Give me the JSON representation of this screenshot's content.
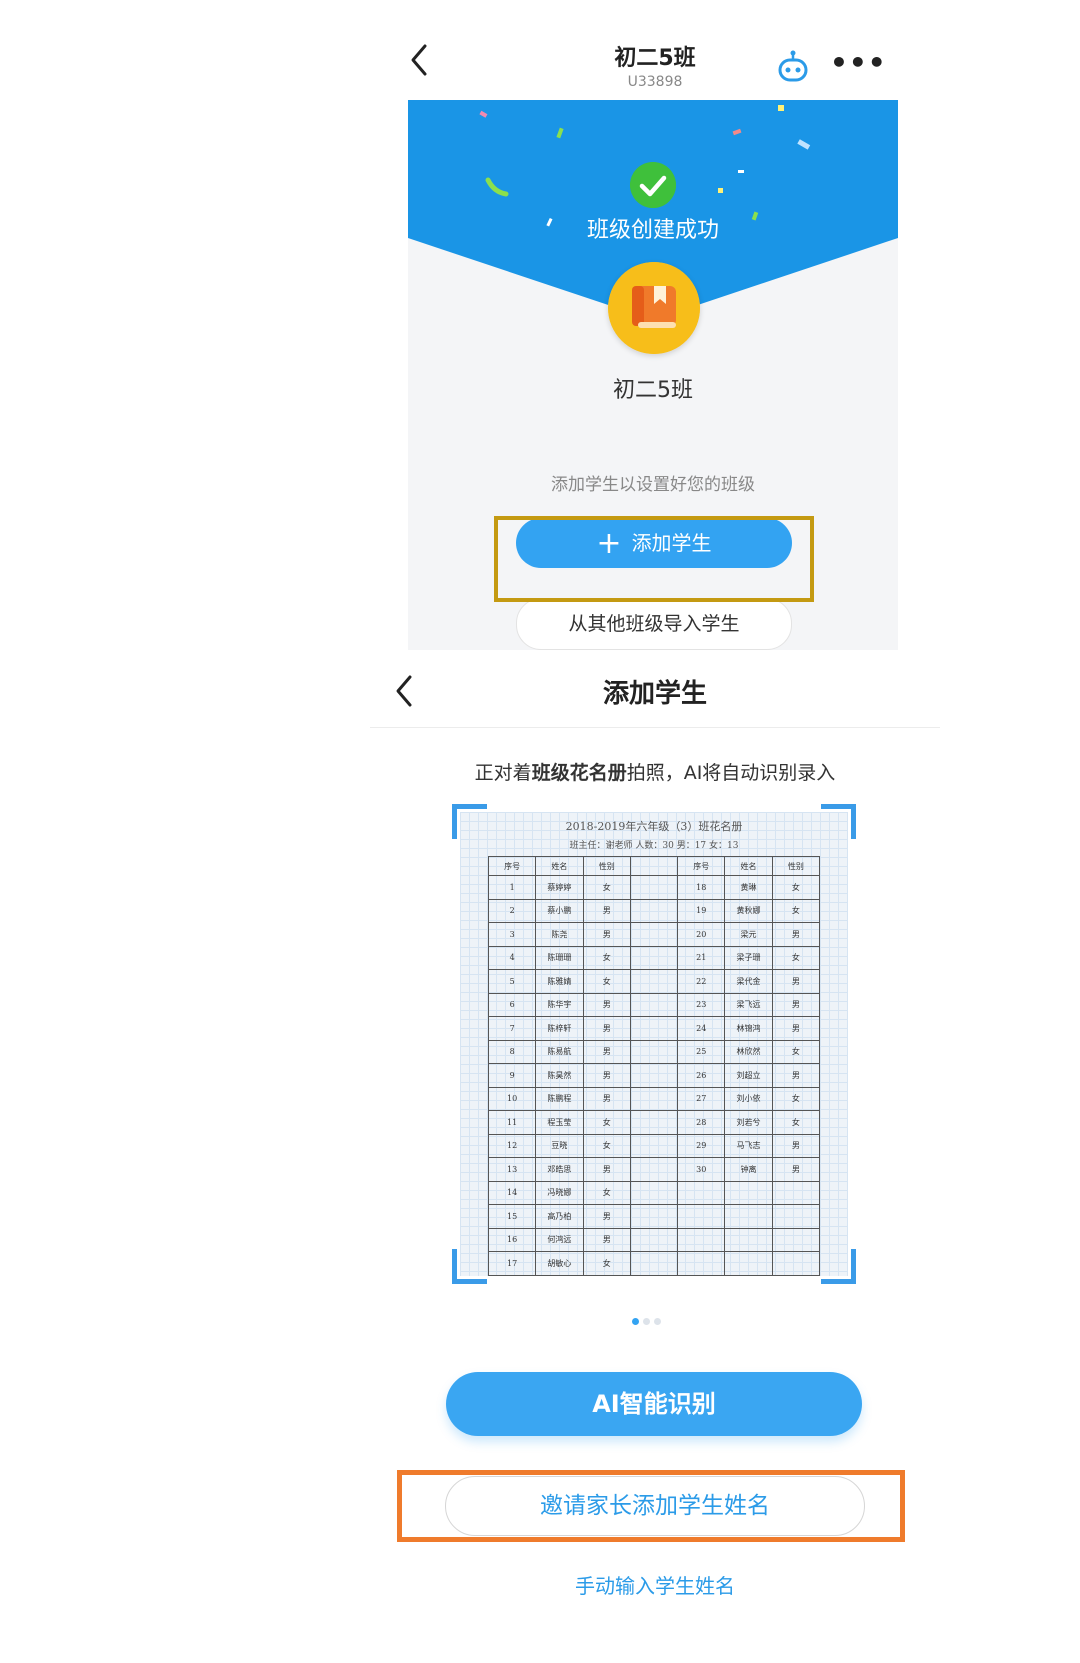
{
  "screen1": {
    "header": {
      "title": "初二5班",
      "subtitle": "U33898",
      "more_glyph": "•••"
    },
    "success_text": "班级创建成功",
    "class_name": "初二5班",
    "hint": "添加学生以设置好您的班级",
    "add_button": {
      "icon": "plus-icon",
      "label": "添加学生"
    },
    "import_button": "从其他班级导入学生"
  },
  "screen2": {
    "header": {
      "title": "添加学生"
    },
    "instruction": {
      "pre": "正对着",
      "bold": "班级花名册",
      "post": "拍照，AI将自动识别录入"
    },
    "roster": {
      "title": "2018-2019年六年级（3）班花名册",
      "info": "班主任：谢老师  人数：30  男：17  女：13",
      "headers": [
        "序号",
        "姓名",
        "性别",
        "",
        "序号",
        "姓名",
        "性别"
      ],
      "rows": [
        [
          "1",
          "蔡婷婷",
          "女",
          "",
          "18",
          "黄琳",
          "女"
        ],
        [
          "2",
          "蔡小鹏",
          "男",
          "",
          "19",
          "黄秋娜",
          "女"
        ],
        [
          "3",
          "陈尧",
          "男",
          "",
          "20",
          "梁元",
          "男"
        ],
        [
          "4",
          "陈珊珊",
          "女",
          "",
          "21",
          "梁子珊",
          "女"
        ],
        [
          "5",
          "陈雅婧",
          "女",
          "",
          "22",
          "梁代金",
          "男"
        ],
        [
          "6",
          "陈华宇",
          "男",
          "",
          "23",
          "梁飞远",
          "男"
        ],
        [
          "7",
          "陈梓轩",
          "男",
          "",
          "24",
          "林锦鸿",
          "男"
        ],
        [
          "8",
          "陈易航",
          "男",
          "",
          "25",
          "林欣然",
          "女"
        ],
        [
          "9",
          "陈昊然",
          "男",
          "",
          "26",
          "刘超立",
          "男"
        ],
        [
          "10",
          "陈鹏程",
          "男",
          "",
          "27",
          "刘小依",
          "女"
        ],
        [
          "11",
          "程玉莹",
          "女",
          "",
          "28",
          "刘若兮",
          "女"
        ],
        [
          "12",
          "豆晓",
          "女",
          "",
          "29",
          "马飞志",
          "男"
        ],
        [
          "13",
          "邓皓思",
          "男",
          "",
          "30",
          "钟离",
          "男"
        ],
        [
          "14",
          "冯晓娜",
          "女",
          "",
          "",
          "",
          ""
        ],
        [
          "15",
          "高乃柏",
          "男",
          "",
          "",
          "",
          ""
        ],
        [
          "16",
          "何鸿远",
          "男",
          "",
          "",
          "",
          ""
        ],
        [
          "17",
          "胡敏心",
          "女",
          "",
          "",
          "",
          ""
        ]
      ]
    },
    "pagination": {
      "total": 3,
      "active": 0
    },
    "ai_button": "AI智能识别",
    "invite_button": "邀请家长添加学生姓名",
    "manual_link": "手动输入学生姓名"
  },
  "colors": {
    "primary_blue": "#33a3f2",
    "banner_blue": "#1a95e6",
    "check_green": "#3fc03b",
    "highlight_gold": "#c49a12",
    "highlight_orange": "#ef7b2c",
    "link_blue": "#2b9be8"
  }
}
